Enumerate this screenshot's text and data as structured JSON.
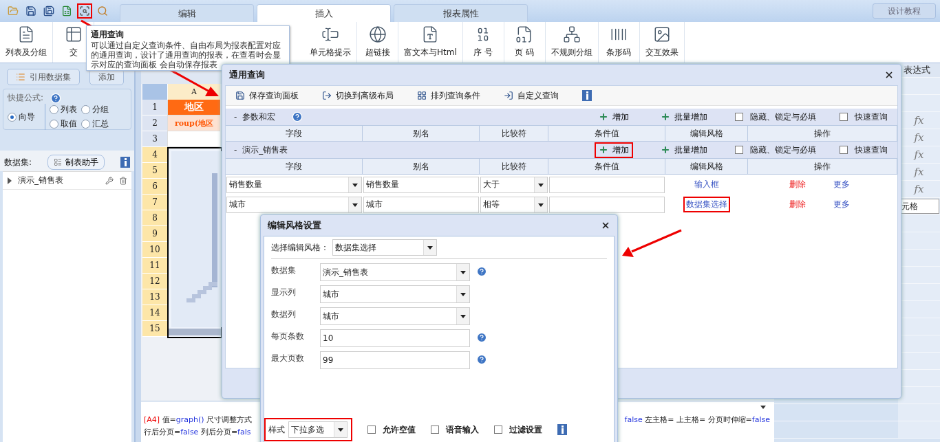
{
  "quick_icons": [
    {
      "kind": "open",
      "highlighted": false
    },
    {
      "kind": "save",
      "highlighted": false
    },
    {
      "kind": "save-as",
      "highlighted": false
    },
    {
      "kind": "excel",
      "highlighted": false
    },
    {
      "kind": "query",
      "highlighted": true
    },
    {
      "kind": "preview",
      "highlighted": false
    }
  ],
  "tabs": [
    {
      "label": "编辑",
      "selected": false
    },
    {
      "label": "插入",
      "selected": true
    },
    {
      "label": "报表属性",
      "selected": false
    }
  ],
  "help_button": "设计教程",
  "ribbon": [
    {
      "label": "列表及分组",
      "kind": "list"
    },
    {
      "label": "交",
      "kind": "cross"
    },
    {
      "label": "单元格提示",
      "kind": "cell-tip"
    },
    {
      "label": "超链接",
      "kind": "link"
    },
    {
      "label": "富文本与Html",
      "kind": "richtext"
    },
    {
      "label": "序 号",
      "kind": "number"
    },
    {
      "label": "页 码",
      "kind": "page"
    },
    {
      "label": "不规则分组",
      "kind": "group"
    },
    {
      "label": "条形码",
      "kind": "barcode"
    },
    {
      "label": "交互效果",
      "kind": "interact"
    }
  ],
  "tooltip": {
    "title": "通用查询",
    "text": "可以通过自定义查询条件、自由布局为报表配置对应的通用查询，设计了通用查询的报表，在查看时会显示对应的查询面板 会自动保存报表"
  },
  "left_panel": {
    "buttons": [
      "引用数据集",
      "添加"
    ],
    "formula_label": "快捷公式:",
    "modes": [
      {
        "label": "向导",
        "selected": true
      },
      {
        "label": "列表",
        "selected": false
      },
      {
        "label": "分组",
        "selected": false
      },
      {
        "label": "取值",
        "selected": false
      },
      {
        "label": "汇总",
        "selected": false
      }
    ],
    "dataset_label": "数据集:",
    "helper_button": "制表助手",
    "datasets": [
      {
        "name": "演示_销售表",
        "expanded": false
      }
    ]
  },
  "sheet": {
    "columns": [
      {
        "label": "A",
        "selected": true
      }
    ],
    "rows": [
      {
        "label": "1",
        "selected": false
      },
      {
        "label": "2",
        "selected": false
      },
      {
        "label": "3",
        "selected": false
      },
      {
        "label": "4",
        "selected": true
      },
      {
        "label": "5",
        "selected": true
      },
      {
        "label": "6",
        "selected": true
      },
      {
        "label": "7",
        "selected": true
      },
      {
        "label": "8",
        "selected": true
      },
      {
        "label": "9",
        "selected": true
      },
      {
        "label": "10",
        "selected": true
      },
      {
        "label": "11",
        "selected": true
      },
      {
        "label": "12",
        "selected": true
      },
      {
        "label": "13",
        "selected": true
      },
      {
        "label": "14",
        "selected": true
      },
      {
        "label": "15",
        "selected": true
      }
    ],
    "cells": [
      {
        "text": "地区",
        "kind": "header"
      },
      {
        "text": "roup(地区",
        "kind": "formula"
      }
    ]
  },
  "right_panel": {
    "header": "表达式",
    "rows": [
      {
        "kind": "empty"
      },
      {
        "kind": "empty"
      },
      {
        "kind": "fx",
        "text": "fx"
      },
      {
        "kind": "fx",
        "text": "fx"
      },
      {
        "kind": "fx",
        "text": "fx"
      },
      {
        "kind": "fx",
        "text": "fx"
      },
      {
        "kind": "fx",
        "text": "fx"
      },
      {
        "kind": "field",
        "text": "元格"
      }
    ]
  },
  "formula_panel": {
    "lines": [
      {
        "left": [
          {
            "text": "[A4]",
            "kind": "ref"
          },
          {
            "text": " 值=",
            "kind": "plain"
          },
          {
            "text": "graph()",
            "kind": "value"
          },
          {
            "text": " 尺寸调整方式",
            "kind": "plain"
          }
        ],
        "right": [
          {
            "text": "false",
            "kind": "value"
          },
          {
            "text": " 左主格= 上主格= 分页时伸缩=",
            "kind": "plain"
          },
          {
            "text": "false",
            "kind": "value"
          }
        ]
      },
      {
        "left": [
          {
            "text": "行后分页=",
            "kind": "plain"
          },
          {
            "text": "false",
            "kind": "value"
          },
          {
            "text": " 列后分页=",
            "kind": "plain"
          },
          {
            "text": "fals",
            "kind": "value"
          }
        ]
      }
    ]
  },
  "query_dialog": {
    "title": "通用查询",
    "toolbar": [
      {
        "label": "保存查询面板",
        "kind": "save"
      },
      {
        "label": "切换到高级布局",
        "kind": "switch"
      },
      {
        "label": "排列查询条件",
        "kind": "arrange"
      },
      {
        "label": "自定义查询",
        "kind": "custom"
      }
    ],
    "sections": [
      {
        "toggle": "-",
        "name": "参数和宏",
        "help": true,
        "add": "增加",
        "add_highlighted": false,
        "batch_add": "批量增加",
        "options": [
          {
            "label": "隐藏、锁定与必填",
            "checked": false
          },
          {
            "label": "快速查询",
            "checked": false
          }
        ],
        "columns": [
          "字段",
          "别名",
          "比较符",
          "条件值",
          "编辑风格",
          "操作"
        ]
      },
      {
        "toggle": "-",
        "name": "演示_销售表",
        "help": false,
        "add": "增加",
        "add_highlighted": true,
        "batch_add": "批量增加",
        "options": [
          {
            "label": "隐藏、锁定与必填",
            "checked": false
          },
          {
            "label": "快速查询",
            "checked": false
          }
        ],
        "columns": [
          "字段",
          "别名",
          "比较符",
          "条件值",
          "编辑风格",
          "操作"
        ],
        "rows": [
          {
            "field": "销售数量",
            "alias": "销售数量",
            "operator": "大于",
            "style": "输入框",
            "style_highlighted": false,
            "delete": "删除",
            "more": "更多"
          },
          {
            "field": "城市",
            "alias": "城市",
            "operator": "相等",
            "style": "数据集选择",
            "style_highlighted": true,
            "delete": "删除",
            "more": "更多"
          }
        ]
      }
    ]
  },
  "style_dialog": {
    "title": "编辑风格设置",
    "style_label": "选择编辑风格：",
    "style_value": "数据集选择",
    "fields": [
      {
        "label": "数据集",
        "value": "演示_销售表",
        "kind": "select",
        "help": true
      },
      {
        "label": "显示列",
        "value": "城市",
        "kind": "select",
        "help": false
      },
      {
        "label": "数据列",
        "value": "城市",
        "kind": "select",
        "help": false
      },
      {
        "label": "每页条数",
        "value": "10",
        "kind": "input",
        "help": true
      },
      {
        "label": "最大页数",
        "value": "99",
        "kind": "input",
        "help": true
      }
    ],
    "footer": {
      "label": "样式",
      "value": "下拉多选",
      "highlighted": true,
      "options": [
        {
          "label": "允许空值",
          "checked": false
        },
        {
          "label": "语音输入",
          "checked": false
        },
        {
          "label": "过滤设置",
          "checked": false
        }
      ]
    }
  }
}
